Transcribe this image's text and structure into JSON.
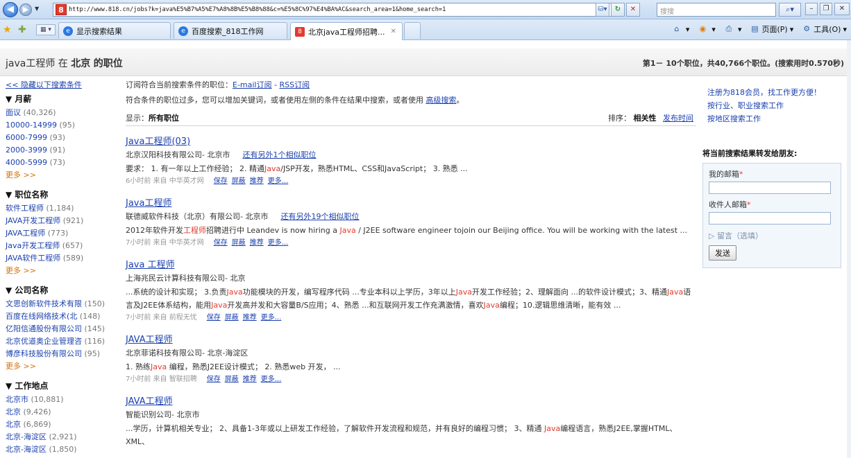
{
  "browser": {
    "url": "http://www.818.cn/jobs?k=java%E5%B7%A5%E7%A8%8B%E5%B8%88&c=%E5%8C%97%E4%BA%AC&search_area=1&home_search=1",
    "search_placeholder": "搜搜",
    "tabs": [
      {
        "label": "显示搜索结果"
      },
      {
        "label": "百度搜索_818工作网"
      },
      {
        "label": "北京java工程师招聘..."
      }
    ],
    "commands": {
      "home": "",
      "feeds": "",
      "print": "",
      "page": "页面(P)",
      "tools": "工具(O)"
    }
  },
  "header": {
    "keyword": "java工程师",
    "in": "在",
    "city": "北京",
    "suffix": "的职位",
    "summary": "第1－ 10个职位，共40,766个职位。(搜索用时0.570秒)"
  },
  "sidebar": {
    "toggle": "<< 隐藏以下搜索条件",
    "more": "更多 >>",
    "groups": [
      {
        "title": "▼ 月薪",
        "items": [
          {
            "label": "面议",
            "count": "(40,326)"
          },
          {
            "label": "10000-14999",
            "count": "(95)"
          },
          {
            "label": "6000-7999",
            "count": "(93)"
          },
          {
            "label": "2000-3999",
            "count": "(91)"
          },
          {
            "label": "4000-5999",
            "count": "(73)"
          }
        ]
      },
      {
        "title": "▼ 职位名称",
        "items": [
          {
            "label": "软件工程师",
            "count": "(1,184)"
          },
          {
            "label": "JAVA开发工程师",
            "count": "(921)"
          },
          {
            "label": "JAVA工程师",
            "count": "(773)"
          },
          {
            "label": "Java开发工程师",
            "count": "(657)"
          },
          {
            "label": "JAVA软件工程师",
            "count": "(589)"
          }
        ]
      },
      {
        "title": "▼ 公司名称",
        "items": [
          {
            "label": "文思创新软件技术有限",
            "count": "(150)"
          },
          {
            "label": "百度在线网络技术(北",
            "count": "(148)"
          },
          {
            "label": "亿阳信通股份有限公司",
            "count": "(145)"
          },
          {
            "label": "北京优道奥企业管理咨",
            "count": "(116)"
          },
          {
            "label": "博彦科技股份有限公司",
            "count": "(95)"
          }
        ]
      },
      {
        "title": "▼ 工作地点",
        "items": [
          {
            "label": "北京市",
            "count": "(10,881)"
          },
          {
            "label": "北京",
            "count": "(9,426)"
          },
          {
            "label": "北京",
            "count": " (6,869)"
          },
          {
            "label": "北京-海淀区",
            "count": "(2,921)"
          },
          {
            "label": "北京-海淀区",
            "count": " (1,850)"
          }
        ]
      }
    ]
  },
  "main": {
    "subscribe": {
      "prefix": "订阅符合当前搜索条件的职位：",
      "email": "E-mail订阅",
      "sep": " - ",
      "rss": "RSS订阅"
    },
    "tip": {
      "text": "符合条件的职位过多，您可以增加关键词，或者使用左侧的条件在结果中搜索，或者使用",
      "link": "高级搜索",
      "end": "。"
    },
    "showing": {
      "label": "显示：",
      "value": "所有职位"
    },
    "sort": {
      "label": "排序：",
      "relevance": "相关性",
      "time": "发布时间"
    },
    "actions": {
      "save": "保存",
      "block": "屏蔽",
      "recommend": "推荐",
      "more": "更多..."
    },
    "jobs": [
      {
        "title": "Java工程师(03)",
        "company": "北京汉阳科技有限公司- 北京市",
        "similar": "还有另外1个相似职位",
        "desc": [
          {
            "t": "要求： 1. 有一年以上工作经验； 2. 精通"
          },
          {
            "k": "Java"
          },
          {
            "t": "/JSP开发，熟悉HTML、CSS和JavaScript； 3. 熟悉 ..."
          }
        ],
        "meta": "6小时前 来自 中华英才网"
      },
      {
        "title": "Java工程师",
        "company": "联德威软件科技（北京）有限公司- 北京市",
        "similar": "还有另外19个相似职位",
        "desc": [
          {
            "t": "2012年软件开发"
          },
          {
            "k": "工程师"
          },
          {
            "t": "招聘进行中 Leandev is now hiring a "
          },
          {
            "k": "Java"
          },
          {
            "t": " / J2EE software engineer tojoin our Beijing office. You will be working with the latest ..."
          }
        ],
        "meta": "7小时前 来自 中华英才网"
      },
      {
        "title": "Java 工程师",
        "company": "上海兆民云计算科技有限公司- 北京",
        "similar": "",
        "desc": [
          {
            "t": "...系统的设计和实现； 3.负责"
          },
          {
            "k": "Java"
          },
          {
            "t": "功能模块的开发，编写程序代码 ...专业本科以上学历，3年以上"
          },
          {
            "k": "Java"
          },
          {
            "t": "开发工作经验；2、理解面向 ...的软件设计模式；3、精通"
          },
          {
            "k": "Java"
          },
          {
            "t": "语言及J2EE体系结构，能用"
          },
          {
            "k": "Java"
          },
          {
            "t": "开发高并发和大容量B/S应用；4、熟悉 ...和互联网开发工作充满激情，喜欢"
          },
          {
            "k": "Java"
          },
          {
            "t": "编程；10.逻辑思维清晰，能有效 ..."
          }
        ],
        "meta": "7小时前 来自 前程无忧"
      },
      {
        "title": "JAVA工程师",
        "company": "北京菲诺科技有限公司- 北京-海淀区",
        "similar": "",
        "desc": [
          {
            "t": "1. 熟练"
          },
          {
            "k": "Java"
          },
          {
            "t": " 编程，熟悉J2EE设计模式； 2. 熟悉web 开发， ..."
          }
        ],
        "meta": "7小时前 来自 智联招聘"
      },
      {
        "title": "JAVA工程师",
        "company": "智能识别公司- 北京市",
        "similar": "",
        "desc": [
          {
            "t": "...学历，计算机相关专业； 2、具备1-3年或以上研发工作经验，了解软件开发流程和规范，并有良好的编程习惯； 3、精通 "
          },
          {
            "k": "Java"
          },
          {
            "t": "编程语言，熟悉J2EE,掌握HTML、XML、"
          }
        ],
        "meta": ""
      }
    ]
  },
  "right": {
    "links": [
      "注册为818会员，找工作更方便！",
      "按行业、职业搜索工作",
      "按地区搜索工作"
    ],
    "forward_title": "将当前搜索结果转发给朋友:",
    "my_email": "我的邮箱",
    "to_email": "收件人邮箱",
    "required_mark": "*",
    "note": "▷ 留言（选填）",
    "send": "发送"
  }
}
